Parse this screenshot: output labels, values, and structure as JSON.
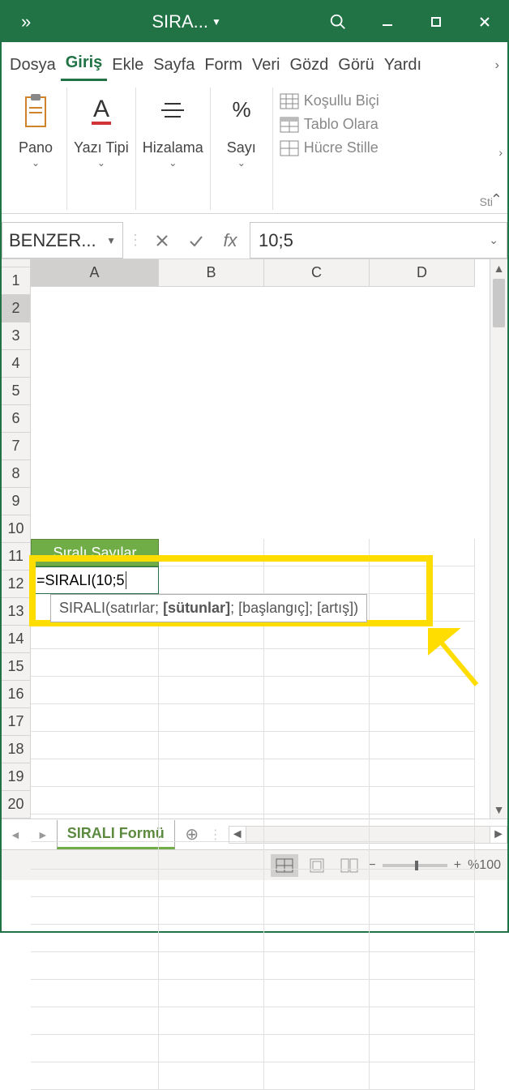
{
  "titlebar": {
    "title": "SIRA...",
    "qat_more": "»"
  },
  "tabs": {
    "items": [
      "Dosya",
      "Giriş",
      "Ekle",
      "Sayfa",
      "Form",
      "Veri",
      "Gözd",
      "Görü",
      "Yardı"
    ],
    "active_index": 1
  },
  "ribbon": {
    "pano": {
      "label": "Pano"
    },
    "yazi": {
      "label": "Yazı Tipi"
    },
    "hizalama": {
      "label": "Hizalama"
    },
    "sayi": {
      "label": "Sayı"
    },
    "styles": {
      "conditional": "Koşullu Biçi",
      "table": "Tablo Olara",
      "cell": "Hücre Stille"
    },
    "group_label": "Sti"
  },
  "namebox": {
    "value": "BENZER..."
  },
  "formulabar": {
    "value": "10;5",
    "fx": "fx"
  },
  "columns": [
    "A",
    "B",
    "C",
    "D"
  ],
  "rows": [
    "1",
    "2",
    "3",
    "4",
    "5",
    "6",
    "7",
    "8",
    "9",
    "10",
    "11",
    "12",
    "13",
    "14",
    "15",
    "16",
    "17",
    "18",
    "19",
    "20"
  ],
  "cells": {
    "A1": "Sıralı Sayılar",
    "A2": "=SIRALI(10;5"
  },
  "tooltip": {
    "fn": "SIRALI",
    "p1": "satırlar",
    "p2": "[sütunlar]",
    "p3": "[başlangıç]",
    "p4": "[artış]"
  },
  "sheet": {
    "name": "SIRALI Formü"
  },
  "statusbar": {
    "zoom": "%100"
  },
  "chart_data": null
}
